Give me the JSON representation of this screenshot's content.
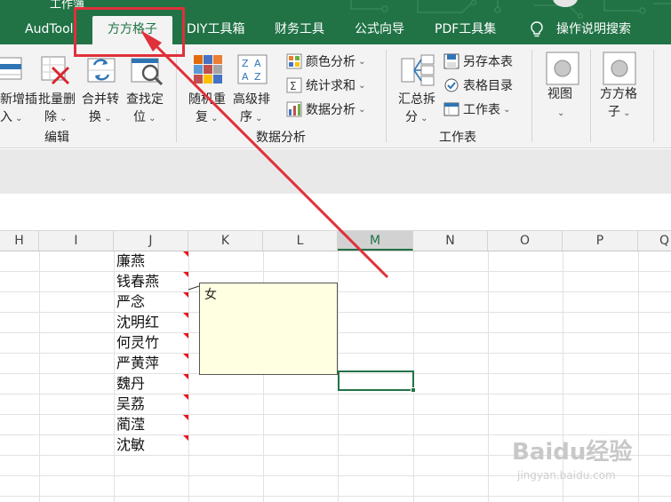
{
  "window": {
    "title_fragment": "工作簿",
    "account_icon": "avatar"
  },
  "tabs": [
    {
      "label": "AudTool",
      "active": false
    },
    {
      "label": "方方格子",
      "active": true
    },
    {
      "label": "DIY工具箱",
      "active": false
    },
    {
      "label": "财务工具",
      "active": false
    },
    {
      "label": "公式向导",
      "active": false
    },
    {
      "label": "PDF工具集",
      "active": false
    }
  ],
  "tell_me": {
    "icon": "lightbulb-icon",
    "label": "操作说明搜索"
  },
  "ribbon": {
    "edit_group": {
      "label": "编辑",
      "buttons": [
        {
          "line1": "新增插",
          "line2": "入",
          "icon": "insert-rows-icon"
        },
        {
          "line1": "批量删",
          "line2": "除",
          "icon": "batch-delete-icon"
        },
        {
          "line1": "合并转",
          "line2": "换",
          "icon": "merge-convert-icon"
        },
        {
          "line1": "查找定",
          "line2": "位",
          "icon": "find-locate-icon"
        }
      ]
    },
    "data_group": {
      "label": "数据分析",
      "buttons": [
        {
          "line1": "随机重",
          "line2": "复",
          "icon": "random-repeat-icon"
        },
        {
          "line1": "高级排",
          "line2": "序",
          "icon": "advanced-sort-icon"
        }
      ],
      "small": [
        {
          "label": "颜色分析",
          "icon": "color-analysis-icon"
        },
        {
          "label": "统计求和",
          "icon": "stat-sum-icon"
        },
        {
          "label": "数据分析",
          "icon": "data-analysis-icon"
        }
      ]
    },
    "sheet_group": {
      "label": "工作表",
      "buttons": [
        {
          "line1": "汇总拆",
          "line2": "分",
          "icon": "summary-split-icon"
        }
      ],
      "small": [
        {
          "label": "另存本表",
          "icon": "save-sheet-icon"
        },
        {
          "label": "表格目录",
          "icon": "sheet-catalog-icon"
        },
        {
          "label": "工作表",
          "icon": "worksheet-icon"
        }
      ]
    },
    "view_group": {
      "buttons": [
        {
          "line1": "视图",
          "line2": "",
          "icon": "view-icon"
        },
        {
          "line1": "方方格",
          "line2": "子",
          "icon": "ffcell-icon"
        }
      ]
    }
  },
  "columns": [
    "H",
    "I",
    "J",
    "K",
    "L",
    "M",
    "N",
    "O",
    "P",
    "Q"
  ],
  "selected_column": "M",
  "names": [
    "廉燕",
    "钱春燕",
    "严念",
    "沈明红",
    "何灵竹",
    "严黄萍",
    "魏丹",
    "吴荔",
    "蔺滢",
    "沈敏"
  ],
  "comment": {
    "text": "女"
  },
  "watermark": {
    "main": "Baidu经验",
    "sub": "jingyan.baidu.com"
  },
  "colors": {
    "excel_green": "#217346",
    "highlight_red": "#e0303a",
    "comment_bg": "#ffffe1",
    "indicator_red": "#e8141c"
  }
}
